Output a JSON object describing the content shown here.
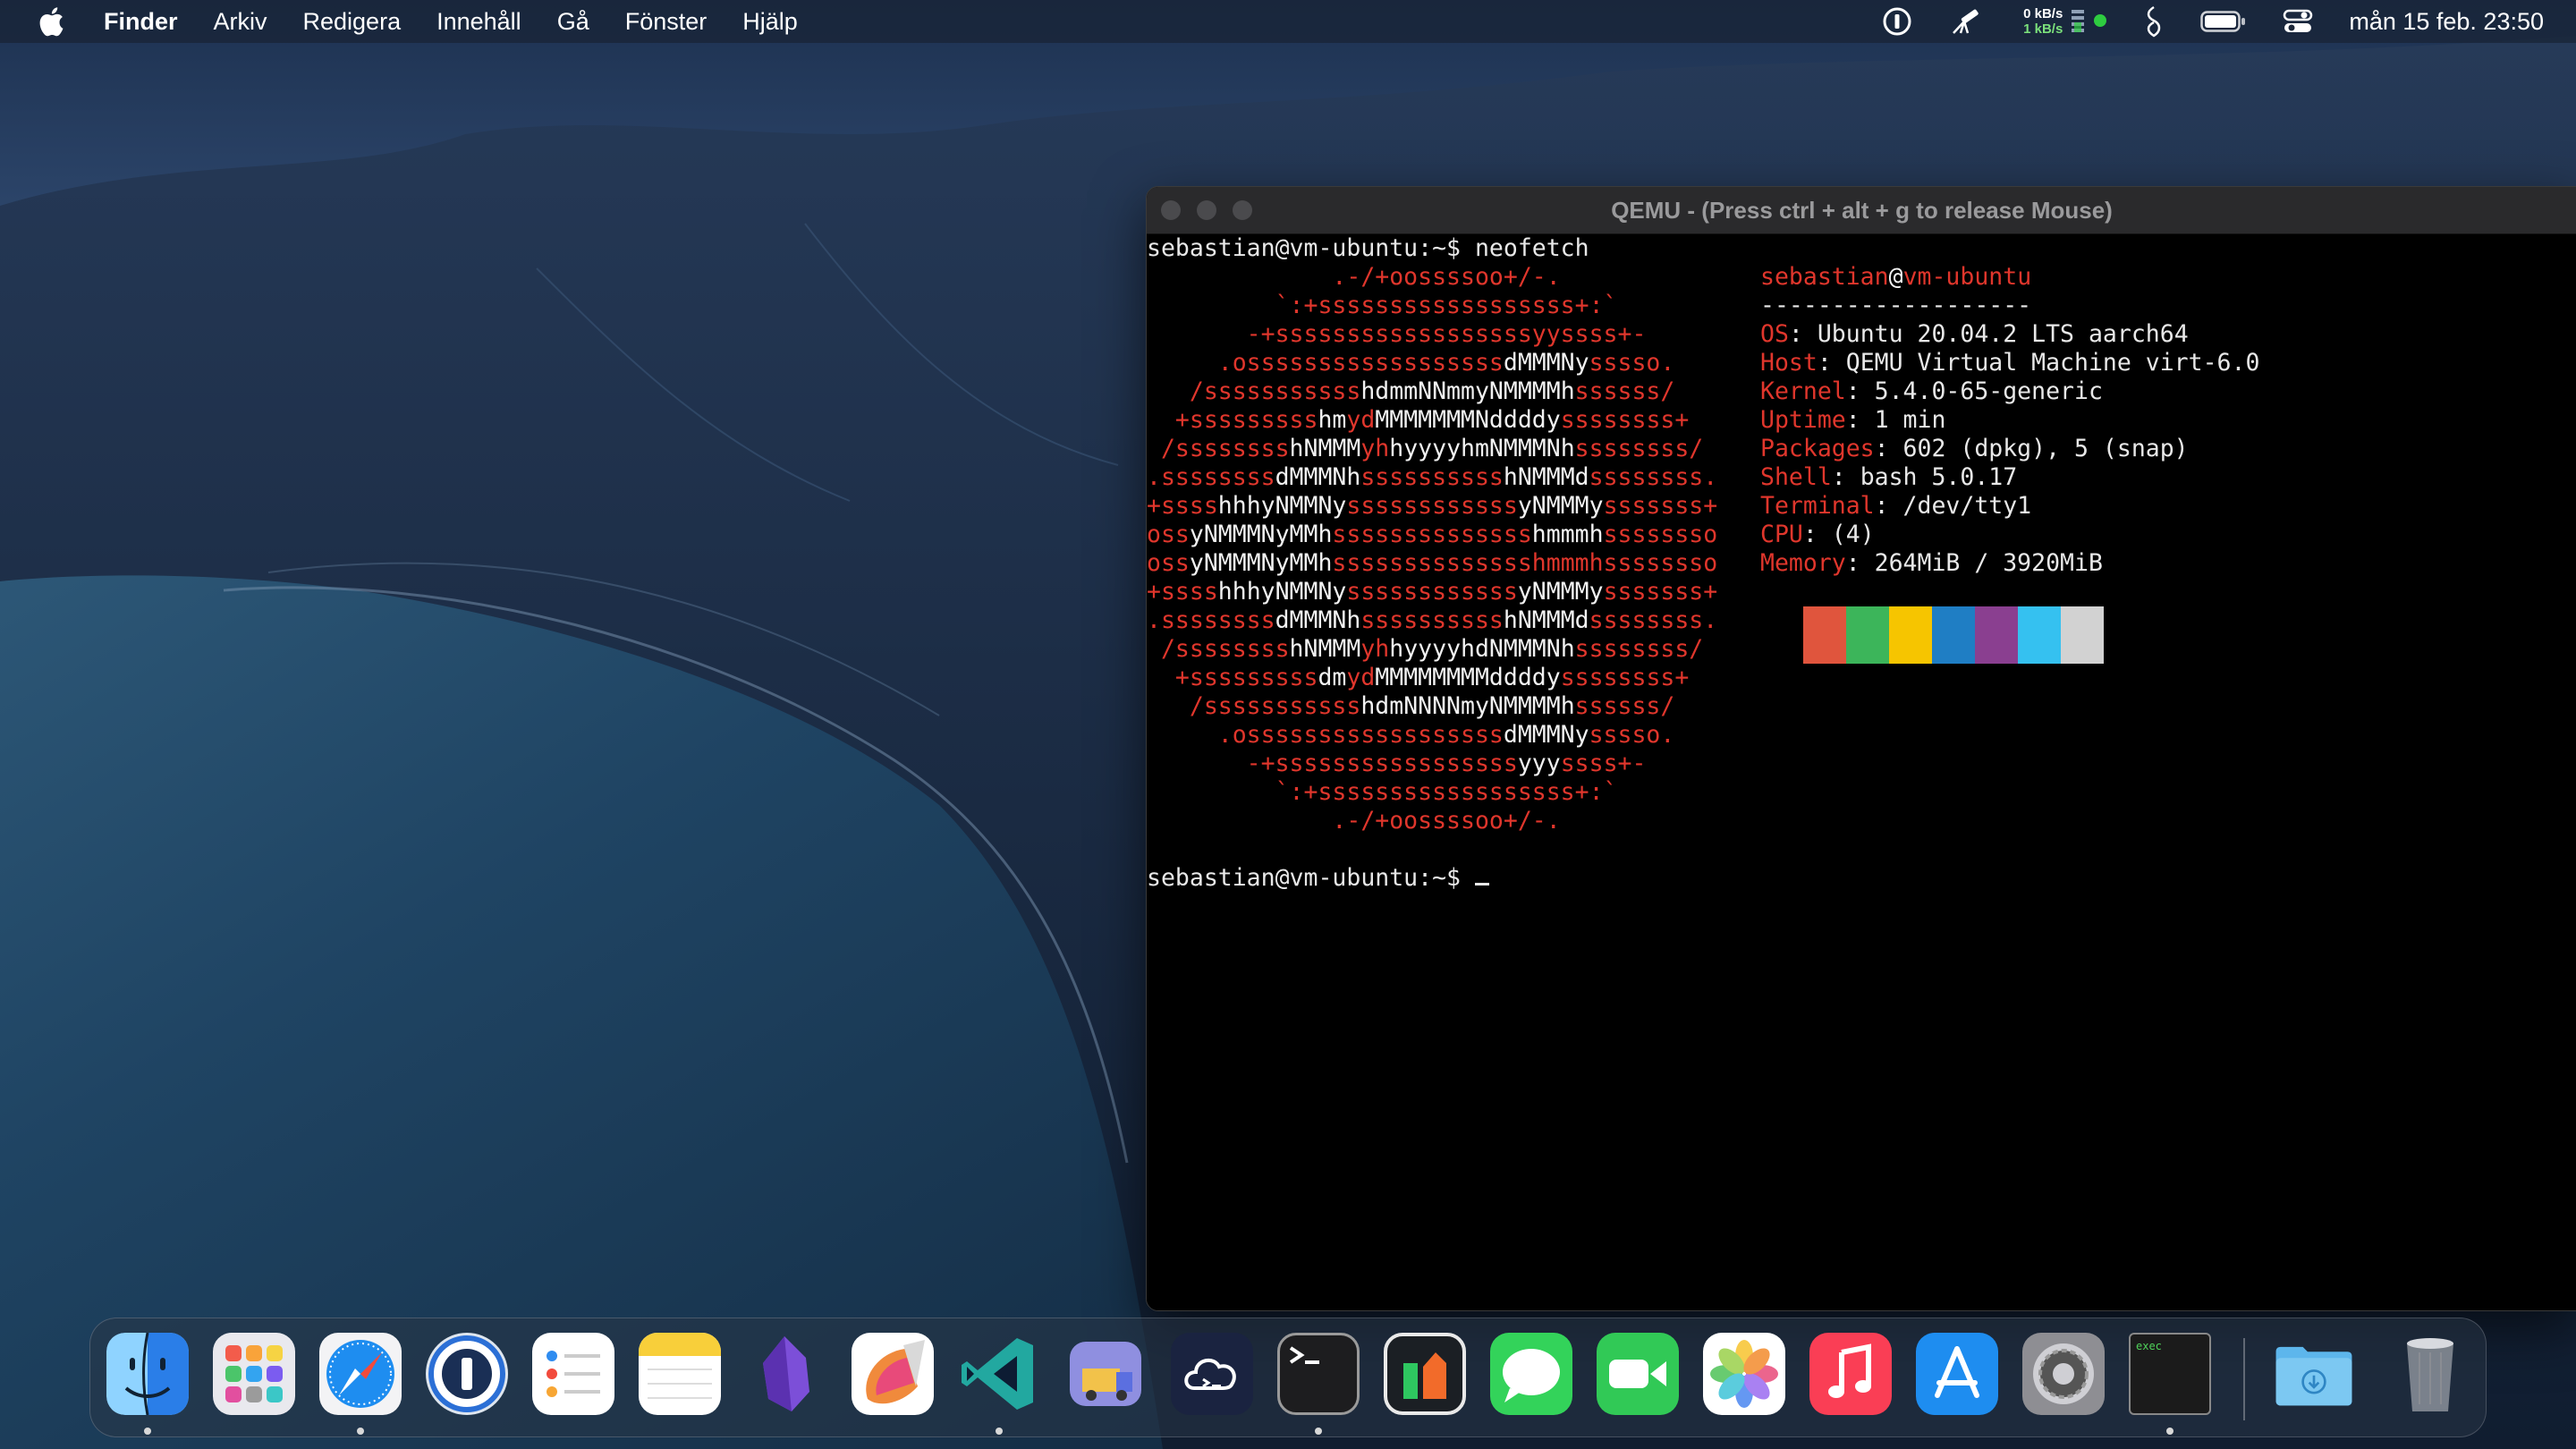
{
  "menubar": {
    "app_name": "Finder",
    "menus": [
      "Arkiv",
      "Redigera",
      "Innehåll",
      "Gå",
      "Fönster",
      "Hjälp"
    ],
    "net_up": "0 kB/s",
    "net_down": "1 kB/s",
    "clock": "mån 15 feb.  23:50"
  },
  "window": {
    "title": "QEMU - (Press ctrl + alt + g to release Mouse)"
  },
  "terminal": {
    "prompt_cmd": "sebastian@vm-ubuntu:~$ neofetch",
    "prompt_end": "sebastian@vm-ubuntu:~$ ",
    "user": "sebastian",
    "host": "vm-ubuntu",
    "separator": "-------------------",
    "info": [
      {
        "label": "OS",
        "value": ": Ubuntu 20.04.2 LTS aarch64"
      },
      {
        "label": "Host",
        "value": ": QEMU Virtual Machine virt-6.0"
      },
      {
        "label": "Kernel",
        "value": ": 5.4.0-65-generic"
      },
      {
        "label": "Uptime",
        "value": ": 1 min"
      },
      {
        "label": "Packages",
        "value": ": 602 (dpkg), 5 (snap)"
      },
      {
        "label": "Shell",
        "value": ": bash 5.0.17"
      },
      {
        "label": "Terminal",
        "value": ": /dev/tty1"
      },
      {
        "label": "CPU",
        "value": ": (4)"
      },
      {
        "label": "Memory",
        "value": ": 264MiB / 3920MiB"
      }
    ],
    "ascii": [
      [
        [
          "r",
          "             .-/+oossssoo+/-."
        ]
      ],
      [
        [
          "r",
          "         `:+ssssssssssssssssss+:`"
        ]
      ],
      [
        [
          "r",
          "       -+ssssssssssssssssssyyssss+-"
        ]
      ],
      [
        [
          "r",
          "     .ossssssssssssssssss"
        ],
        [
          "w",
          "dMMMNy"
        ],
        [
          "r",
          "sssso."
        ]
      ],
      [
        [
          "r",
          "   /sssssssssss"
        ],
        [
          "w",
          "hdmmNNmmyNMMMMh"
        ],
        [
          "r",
          "ssssss/"
        ]
      ],
      [
        [
          "r",
          "  +sssssssss"
        ],
        [
          "w",
          "hm"
        ],
        [
          "r",
          "yd"
        ],
        [
          "w",
          "MMMMMMMNddddy"
        ],
        [
          "r",
          "ssssssss+"
        ]
      ],
      [
        [
          "r",
          " /ssssssss"
        ],
        [
          "w",
          "hNMMM"
        ],
        [
          "r",
          "yh"
        ],
        [
          "w",
          "hyyyyhmNMMMNh"
        ],
        [
          "r",
          "ssssssss/"
        ]
      ],
      [
        [
          "r",
          ".ssssssss"
        ],
        [
          "w",
          "dMMMNh"
        ],
        [
          "r",
          "ssssssssss"
        ],
        [
          "w",
          "hNMMMd"
        ],
        [
          "r",
          "ssssssss."
        ]
      ],
      [
        [
          "r",
          "+ssss"
        ],
        [
          "w",
          "hhhyNMMNy"
        ],
        [
          "r",
          "ssssssssssss"
        ],
        [
          "w",
          "yNMMMy"
        ],
        [
          "r",
          "sssssss+"
        ]
      ],
      [
        [
          "r",
          "oss"
        ],
        [
          "w",
          "yNMMMNyMMh"
        ],
        [
          "r",
          "ssssssssssssss"
        ],
        [
          "w",
          "hmmmh"
        ],
        [
          "r",
          "ssssssso"
        ]
      ],
      [
        [
          "r",
          "oss"
        ],
        [
          "w",
          "yNMMMNyMMh"
        ],
        [
          "r",
          "sssssssssssssshmmmhssssssso"
        ]
      ],
      [
        [
          "r",
          "+ssss"
        ],
        [
          "w",
          "hhhyNMMNy"
        ],
        [
          "r",
          "ssssssssssss"
        ],
        [
          "w",
          "yNMMMy"
        ],
        [
          "r",
          "sssssss+"
        ]
      ],
      [
        [
          "r",
          ".ssssssss"
        ],
        [
          "w",
          "dMMMNh"
        ],
        [
          "r",
          "ssssssssss"
        ],
        [
          "w",
          "hNMMMd"
        ],
        [
          "r",
          "ssssssss."
        ]
      ],
      [
        [
          "r",
          " /ssssssss"
        ],
        [
          "w",
          "hNMMM"
        ],
        [
          "r",
          "yh"
        ],
        [
          "w",
          "hyyyyhdNMMMNh"
        ],
        [
          "r",
          "ssssssss/"
        ]
      ],
      [
        [
          "r",
          "  +sssssssss"
        ],
        [
          "w",
          "dm"
        ],
        [
          "r",
          "yd"
        ],
        [
          "w",
          "MMMMMMMMddddy"
        ],
        [
          "r",
          "ssssssss+"
        ]
      ],
      [
        [
          "r",
          "   /sssssssssss"
        ],
        [
          "w",
          "hdmNNNNmyNMMMMh"
        ],
        [
          "r",
          "ssssss/"
        ]
      ],
      [
        [
          "r",
          "     .ossssssssssssssssss"
        ],
        [
          "w",
          "dMMMNy"
        ],
        [
          "r",
          "sssso."
        ]
      ],
      [
        [
          "r",
          "       -+sssssssssssssssss"
        ],
        [
          "w",
          "yyy"
        ],
        [
          "r",
          "ssss+-"
        ]
      ],
      [
        [
          "r",
          "         `:+ssssssssssssssssss+:`"
        ]
      ],
      [
        [
          "r",
          "             .-/+oossssoo+/-."
        ]
      ]
    ],
    "swatches": [
      "#e0553d",
      "#3cb55a",
      "#f6c500",
      "#1f7ec4",
      "#8a3f90",
      "#35c1f0",
      "#d2d2d2"
    ]
  },
  "dock": {
    "apps": [
      "Finder",
      "Launchpad",
      "Safari",
      "1Password",
      "Reminders",
      "Notes",
      "Obsidian",
      "Pixelmator Pro",
      "Visual Studio Code",
      "Transmit",
      "Cloudflare WARP",
      "Terminal",
      "Vectorian",
      "Messages",
      "FaceTime",
      "Photos",
      "Music",
      "App Store",
      "System Preferences",
      "exec",
      "Downloads",
      "Trash"
    ],
    "exec_label": "exec"
  }
}
